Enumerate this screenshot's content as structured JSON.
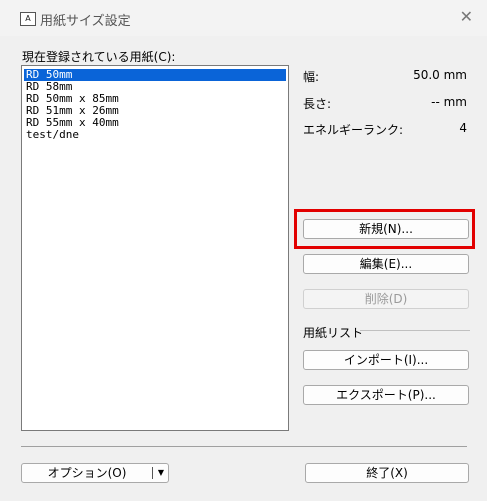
{
  "window": {
    "title": "用紙サイズ設定",
    "icon_text": "A"
  },
  "paper_list": {
    "label": "現在登録されている用紙(C):",
    "items": [
      "RD 50mm",
      "RD 58mm",
      "RD 50mm x 85mm",
      "RD 51mm x 26mm",
      "RD 55mm x 40mm",
      "test/dne"
    ],
    "selected_index": 0
  },
  "properties": {
    "width_label": "幅:",
    "width_value": "50.0 mm",
    "length_label": "長さ:",
    "length_value": "-- mm",
    "energy_label": "エネルギーランク:",
    "energy_value": "4"
  },
  "buttons": {
    "new": "新規(N)...",
    "edit": "編集(E)...",
    "delete": "削除(D)",
    "import": "インポート(I)...",
    "export": "エクスポート(P)...",
    "options": "オプション(O)",
    "close": "終了(X)"
  },
  "paper_list_group": {
    "label": "用紙リスト"
  },
  "colors": {
    "highlight": "#e20000",
    "selection": "#0a64d8"
  }
}
